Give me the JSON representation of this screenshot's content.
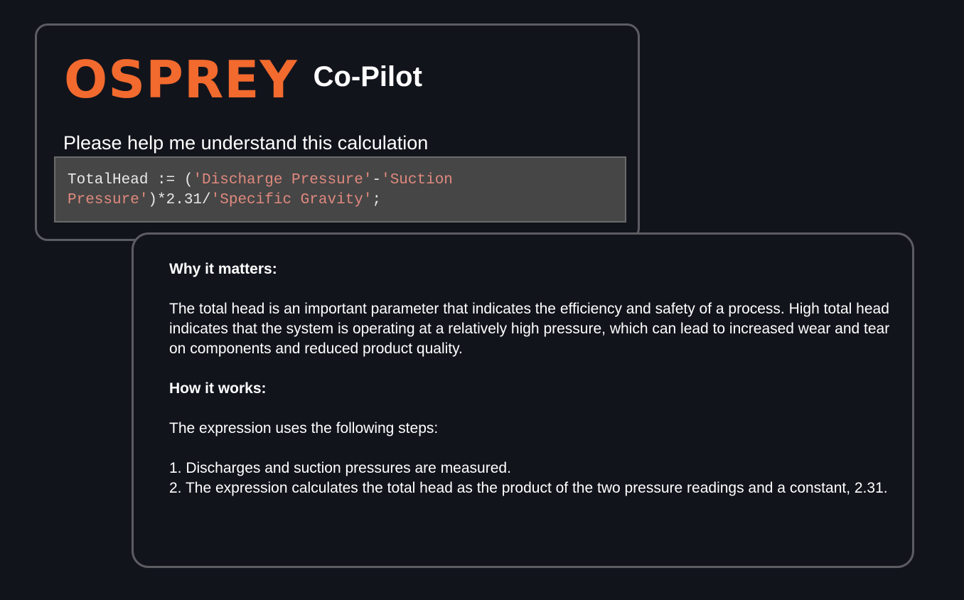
{
  "brand": {
    "logo_text": "OSPREY",
    "product_name": "Co-Pilot",
    "logo_color": "#f26a2e"
  },
  "prompt": {
    "text": "Please help me understand this calculation"
  },
  "code": {
    "tokens": [
      {
        "type": "plain",
        "text": "TotalHead := ("
      },
      {
        "type": "string",
        "text": "'Discharge Pressure'"
      },
      {
        "type": "plain",
        "text": "-"
      },
      {
        "type": "string",
        "text": "'Suction Pressure'"
      },
      {
        "type": "plain",
        "text": ")*2.31/"
      },
      {
        "type": "string",
        "text": "'Specific Gravity'"
      },
      {
        "type": "plain",
        "text": ";"
      }
    ],
    "string_color": "#e0897e"
  },
  "answer": {
    "why_heading": "Why it matters:",
    "why_text": "The total head is an important parameter that indicates the efficiency and safety of a process. High total head indicates that the system is operating at a relatively high pressure, which can lead to increased wear and tear on components and reduced product quality.",
    "how_heading": "How it works:",
    "how_intro": "The expression uses the following steps:",
    "steps": [
      "1. Discharges and suction pressures are measured.",
      "2. The expression calculates the total head as the product of the two pressure readings and a constant, 2.31."
    ]
  }
}
